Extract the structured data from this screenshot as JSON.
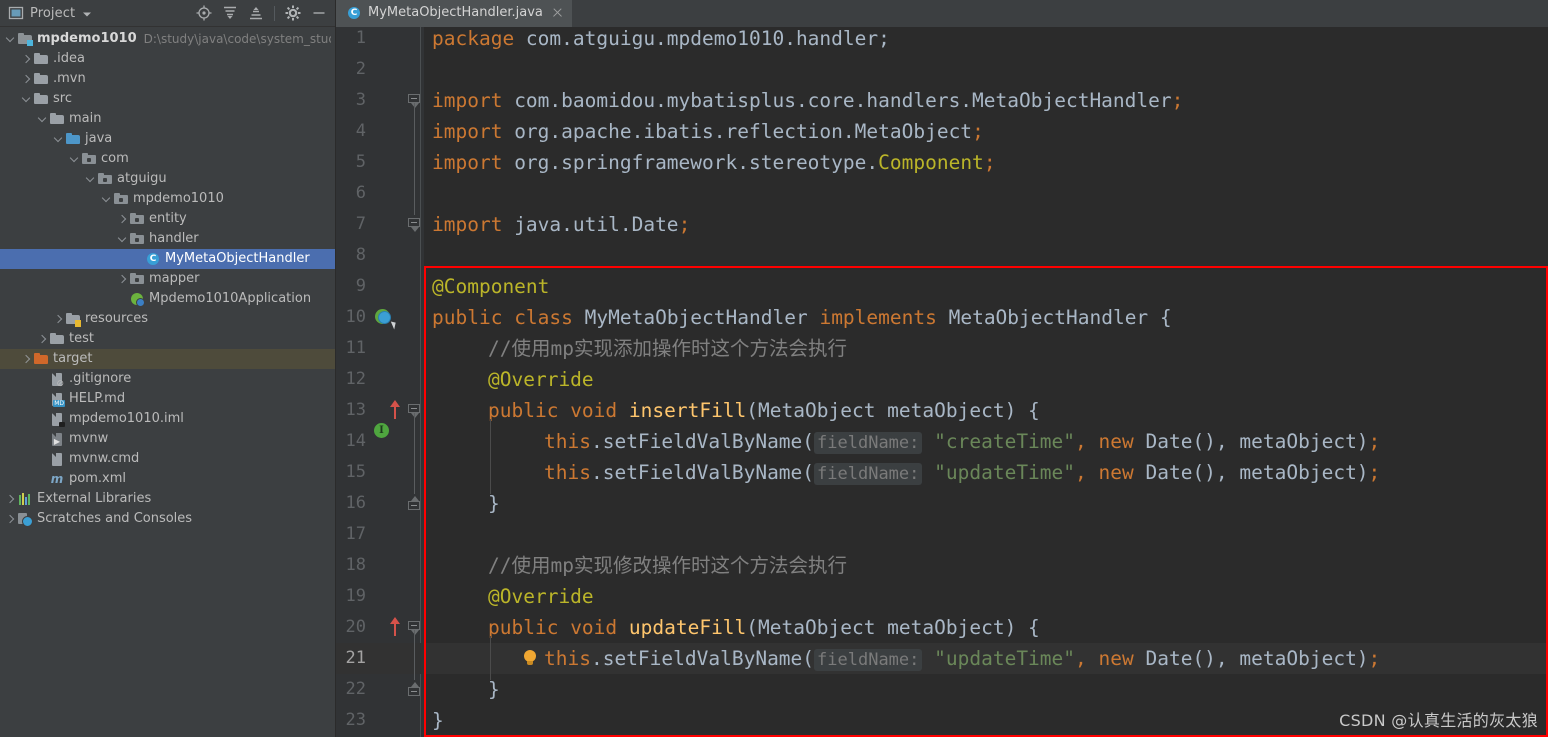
{
  "project_panel": {
    "title": "Project",
    "dropdown_icon": "chevron-down-icon",
    "toolbar_icons": [
      "locate-target-icon",
      "expand-all-icon",
      "collapse-all-icon",
      "settings-gear-icon",
      "minimize-icon"
    ],
    "tree": [
      {
        "label": "mpdemo1010",
        "path": "D:\\study\\java\\code\\system_study\\",
        "depth": 0,
        "arrow": "down",
        "icon": "project-folder-icon",
        "bold": true
      },
      {
        "label": ".idea",
        "depth": 1,
        "arrow": "right",
        "icon": "folder-icon"
      },
      {
        "label": ".mvn",
        "depth": 1,
        "arrow": "right",
        "icon": "folder-icon"
      },
      {
        "label": "src",
        "depth": 1,
        "arrow": "down",
        "icon": "folder-icon"
      },
      {
        "label": "main",
        "depth": 2,
        "arrow": "down",
        "icon": "folder-icon"
      },
      {
        "label": "java",
        "depth": 3,
        "arrow": "down",
        "icon": "source-folder-icon"
      },
      {
        "label": "com",
        "depth": 4,
        "arrow": "down",
        "icon": "package-icon"
      },
      {
        "label": "atguigu",
        "depth": 5,
        "arrow": "down",
        "icon": "package-icon"
      },
      {
        "label": "mpdemo1010",
        "depth": 6,
        "arrow": "down",
        "icon": "package-icon"
      },
      {
        "label": "entity",
        "depth": 7,
        "arrow": "right",
        "icon": "package-icon"
      },
      {
        "label": "handler",
        "depth": 7,
        "arrow": "down",
        "icon": "package-icon"
      },
      {
        "label": "MyMetaObjectHandler",
        "depth": 8,
        "arrow": "none",
        "icon": "java-class-icon",
        "selected": true
      },
      {
        "label": "mapper",
        "depth": 7,
        "arrow": "right",
        "icon": "package-icon"
      },
      {
        "label": "Mpdemo1010Application",
        "depth": 7,
        "arrow": "none",
        "icon": "spring-boot-app-icon"
      },
      {
        "label": "resources",
        "depth": 3,
        "arrow": "right",
        "icon": "resources-folder-icon"
      },
      {
        "label": "test",
        "depth": 2,
        "arrow": "right",
        "icon": "folder-icon"
      },
      {
        "label": "target",
        "depth": 1,
        "arrow": "right",
        "icon": "excluded-folder-icon",
        "context": true
      },
      {
        "label": ".gitignore",
        "depth": 2,
        "arrow": "none",
        "icon": "gitignore-file-icon"
      },
      {
        "label": "HELP.md",
        "depth": 2,
        "arrow": "none",
        "icon": "markdown-file-icon"
      },
      {
        "label": "mpdemo1010.iml",
        "depth": 2,
        "arrow": "none",
        "icon": "iml-file-icon"
      },
      {
        "label": "mvnw",
        "depth": 2,
        "arrow": "none",
        "icon": "shell-script-icon"
      },
      {
        "label": "mvnw.cmd",
        "depth": 2,
        "arrow": "none",
        "icon": "cmd-script-icon"
      },
      {
        "label": "pom.xml",
        "depth": 2,
        "arrow": "none",
        "icon": "maven-pom-icon"
      },
      {
        "label": "External Libraries",
        "depth": 0,
        "arrow": "right",
        "icon": "external-libraries-icon"
      },
      {
        "label": "Scratches and Consoles",
        "depth": 0,
        "arrow": "right",
        "icon": "scratches-icon"
      }
    ]
  },
  "editor": {
    "tab": {
      "label": "MyMetaObjectHandler.java",
      "icon": "java-class-icon",
      "close_icon": "close-icon"
    },
    "current_line": 21,
    "lines": [
      {
        "n": 1,
        "tokens": [
          {
            "t": "package ",
            "c": "kw"
          },
          {
            "t": "com.atguigu.mpdemo1010.handler;",
            "c": "id"
          }
        ]
      },
      {
        "n": 2,
        "tokens": []
      },
      {
        "n": 3,
        "tokens": [
          {
            "t": "import ",
            "c": "kw"
          },
          {
            "t": "com.baomidou.mybatisplus.core.handlers.MetaObjectHandler",
            "c": "id"
          },
          {
            "t": ";",
            "c": "kw"
          }
        ],
        "fold": "down"
      },
      {
        "n": 4,
        "tokens": [
          {
            "t": "import ",
            "c": "kw"
          },
          {
            "t": "org.apache.ibatis.reflection.MetaObject",
            "c": "id"
          },
          {
            "t": ";",
            "c": "kw"
          }
        ]
      },
      {
        "n": 5,
        "tokens": [
          {
            "t": "import ",
            "c": "kw"
          },
          {
            "t": "org.springframework.stereotype.",
            "c": "id"
          },
          {
            "t": "Component",
            "c": "ann"
          },
          {
            "t": ";",
            "c": "kw"
          }
        ]
      },
      {
        "n": 6,
        "tokens": []
      },
      {
        "n": 7,
        "tokens": [
          {
            "t": "import ",
            "c": "kw"
          },
          {
            "t": "java.util.Date",
            "c": "id"
          },
          {
            "t": ";",
            "c": "kw"
          }
        ],
        "fold": "single"
      },
      {
        "n": 8,
        "tokens": []
      },
      {
        "n": 9,
        "tokens": [
          {
            "t": "@Component",
            "c": "ann"
          }
        ]
      },
      {
        "n": 10,
        "tokens": [
          {
            "t": "public ",
            "c": "kw"
          },
          {
            "t": "class ",
            "c": "kw"
          },
          {
            "t": "MyMetaObjectHandler ",
            "c": "id"
          },
          {
            "t": "implements ",
            "c": "kw"
          },
          {
            "t": "MetaObjectHandler {",
            "c": "id"
          }
        ],
        "gutter": "implemented-method-icon"
      },
      {
        "n": 11,
        "indent": 1,
        "tokens": [
          {
            "t": "//使用mp实现添加操作时这个方法会执行",
            "c": "cmt"
          }
        ]
      },
      {
        "n": 12,
        "indent": 1,
        "tokens": [
          {
            "t": "@Override",
            "c": "ann"
          }
        ]
      },
      {
        "n": 13,
        "indent": 1,
        "tokens": [
          {
            "t": "public ",
            "c": "kw"
          },
          {
            "t": "void ",
            "c": "kw"
          },
          {
            "t": "insertFill",
            "c": "mth"
          },
          {
            "t": "(MetaObject metaObject) {",
            "c": "id"
          }
        ],
        "gutter": "override-method-icon",
        "fold": "down"
      },
      {
        "n": 14,
        "indent": 2,
        "tokens": [
          {
            "t": "this",
            "c": "kw"
          },
          {
            "t": ".setFieldValByName(",
            "c": "id"
          },
          {
            "t": "fieldName:",
            "c": "hint"
          },
          {
            "t": " ",
            "c": "id"
          },
          {
            "t": "\"createTime\"",
            "c": "str"
          },
          {
            "t": ", ",
            "c": "kw"
          },
          {
            "t": "new ",
            "c": "kw"
          },
          {
            "t": "Date(), metaObject)",
            "c": "id"
          },
          {
            "t": ";",
            "c": "kw"
          }
        ]
      },
      {
        "n": 15,
        "indent": 2,
        "tokens": [
          {
            "t": "this",
            "c": "kw"
          },
          {
            "t": ".setFieldValByName(",
            "c": "id"
          },
          {
            "t": "fieldName:",
            "c": "hint"
          },
          {
            "t": " ",
            "c": "id"
          },
          {
            "t": "\"updateTime\"",
            "c": "str"
          },
          {
            "t": ", ",
            "c": "kw"
          },
          {
            "t": "new ",
            "c": "kw"
          },
          {
            "t": "Date(), metaObject)",
            "c": "id"
          },
          {
            "t": ";",
            "c": "kw"
          }
        ]
      },
      {
        "n": 16,
        "indent": 1,
        "tokens": [
          {
            "t": "}",
            "c": "id"
          }
        ],
        "fold": "up"
      },
      {
        "n": 17,
        "tokens": []
      },
      {
        "n": 18,
        "indent": 1,
        "tokens": [
          {
            "t": "//使用mp实现修改操作时这个方法会执行",
            "c": "cmt"
          }
        ]
      },
      {
        "n": 19,
        "indent": 1,
        "tokens": [
          {
            "t": "@Override",
            "c": "ann"
          }
        ]
      },
      {
        "n": 20,
        "indent": 1,
        "tokens": [
          {
            "t": "public ",
            "c": "kw"
          },
          {
            "t": "void ",
            "c": "kw"
          },
          {
            "t": "updateFill",
            "c": "mth"
          },
          {
            "t": "(MetaObject metaObject) {",
            "c": "id"
          }
        ],
        "gutter": "override-method-icon",
        "fold": "down"
      },
      {
        "n": 21,
        "indent": 2,
        "tokens": [
          {
            "t": "this",
            "c": "kw"
          },
          {
            "t": ".setFieldValByName(",
            "c": "id"
          },
          {
            "t": "fieldName:",
            "c": "hint"
          },
          {
            "t": " ",
            "c": "id"
          },
          {
            "t": "\"updateTime\"",
            "c": "str"
          },
          {
            "t": ", ",
            "c": "kw"
          },
          {
            "t": "new ",
            "c": "kw"
          },
          {
            "t": "Date(), metaObject)",
            "c": "id"
          },
          {
            "t": ";",
            "c": "kw"
          }
        ],
        "gutter": "intention-bulb-icon"
      },
      {
        "n": 22,
        "indent": 1,
        "tokens": [
          {
            "t": "}",
            "c": "id"
          }
        ],
        "fold": "up"
      },
      {
        "n": 23,
        "tokens": [
          {
            "t": "}",
            "c": "id"
          }
        ]
      }
    ],
    "highlight_box": {
      "color": "#ff0000"
    }
  },
  "watermark": {
    "text": "CSDN @认真生活的灰太狼"
  },
  "colors": {
    "editor_bg": "#2b2b2b",
    "panel_bg": "#3c3f41",
    "gutter_bg": "#313335",
    "selection": "#4b6eaf",
    "keyword": "#cc7832",
    "annotation": "#bbb529",
    "string": "#6a8759",
    "comment": "#808080",
    "method": "#ffc66d",
    "identifier": "#a9b7c6",
    "current_line": "#323232",
    "highlight_border": "#ff0000"
  }
}
